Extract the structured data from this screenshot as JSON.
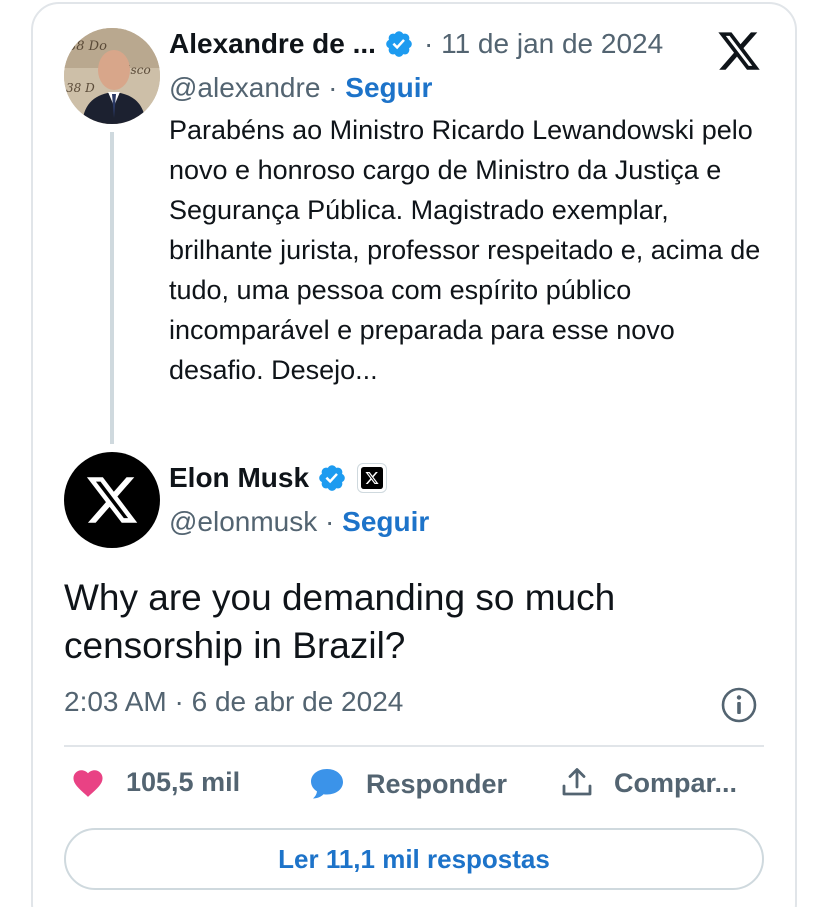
{
  "quoted_tweet": {
    "author_name": "Alexandre de ...",
    "date": "· 11 de jan de 2024",
    "handle": "@alexandre",
    "separator": " · ",
    "follow_label": "Seguir",
    "text": "Parabéns ao Ministro Ricardo Lewandowski pelo novo e honroso cargo de Ministro da Justiça e Segurança Pública. Magistrado exemplar, brilhante jurista, professor respeitado e, acima de tudo, uma pessoa com espírito público incomparável e preparada para esse novo desafio. Desejo..."
  },
  "main_tweet": {
    "author_name": "Elon Musk",
    "handle": "@elonmusk",
    "separator": " · ",
    "follow_label": "Seguir",
    "text": "Why are you demanding so much censorship in Brazil?",
    "timestamp": "2:03 AM · 6 de abr de 2024"
  },
  "actions": {
    "likes": "105,5 mil",
    "reply_label": "Responder",
    "share_label": "Compar..."
  },
  "read_replies_label": "Ler 11,1 mil respostas",
  "colors": {
    "verified": "#1d9bf0",
    "like": "#e94284",
    "reply": "#3b93e9",
    "link": "#1d73c9"
  },
  "icons": [
    "verified-badge-icon",
    "x-logo-icon",
    "info-icon",
    "heart-icon",
    "reply-bubble-icon",
    "share-icon"
  ]
}
